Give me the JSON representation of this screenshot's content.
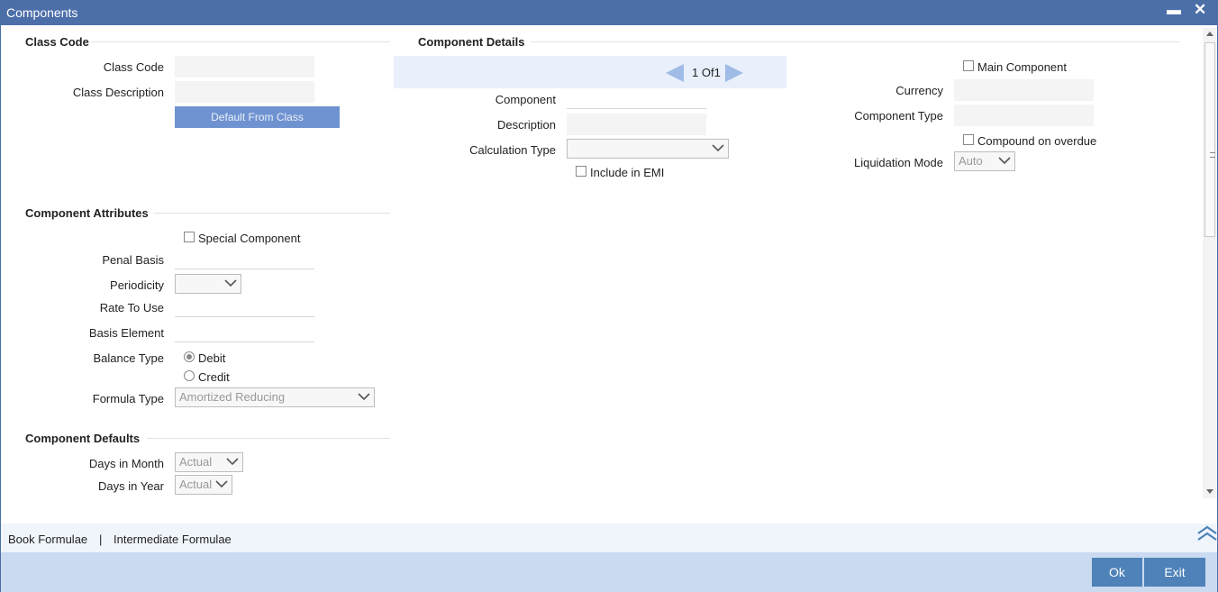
{
  "window": {
    "title": "Components",
    "minimize_glyph": "▬",
    "close_glyph": "✕"
  },
  "class_code": {
    "section_title": "Class Code",
    "class_code_label": "Class Code",
    "class_code_value": "",
    "class_description_label": "Class Description",
    "class_description_value": "",
    "default_button": "Default From Class"
  },
  "component_details": {
    "section_title": "Component Details",
    "nav": {
      "current": "1",
      "of_label": "Of",
      "total": "1"
    },
    "component_label": "Component",
    "component_value": "",
    "description_label": "Description",
    "description_value": "",
    "calculation_type_label": "Calculation Type",
    "calculation_type_value": "",
    "include_in_emi_label": "Include in EMI",
    "include_in_emi_checked": false,
    "main_component_label": "Main Component",
    "main_component_checked": false,
    "currency_label": "Currency",
    "currency_value": "",
    "component_type_label": "Component Type",
    "component_type_value": "",
    "compound_on_overdue_label": "Compound on overdue",
    "compound_on_overdue_checked": false,
    "liquidation_mode_label": "Liquidation Mode",
    "liquidation_mode_value": "Auto"
  },
  "component_attributes": {
    "section_title": "Component Attributes",
    "special_component_label": "Special Component",
    "special_component_checked": false,
    "penal_basis_label": "Penal Basis",
    "penal_basis_value": "",
    "periodicity_label": "Periodicity",
    "periodicity_value": "",
    "rate_to_use_label": "Rate To Use",
    "rate_to_use_value": "",
    "basis_element_label": "Basis Element",
    "basis_element_value": "",
    "balance_type_label": "Balance Type",
    "balance_type_options": [
      "Debit",
      "Credit"
    ],
    "balance_type_selected": "Debit",
    "formula_type_label": "Formula Type",
    "formula_type_value": "Amortized Reducing"
  },
  "component_defaults": {
    "section_title": "Component Defaults",
    "days_in_month_label": "Days in Month",
    "days_in_month_value": "Actual",
    "days_in_year_label": "Days in Year",
    "days_in_year_value": "Actual"
  },
  "footer_links": {
    "book_formulae": "Book Formulae",
    "separator": "|",
    "intermediate_formulae": "Intermediate Formulae"
  },
  "footer_buttons": {
    "ok": "Ok",
    "exit": "Exit"
  },
  "colors": {
    "titlebar": "#4c6ea9",
    "accent_button": "#4f82b8",
    "footer_bar": "#c9daf1",
    "nav_arrow": "#9fbbe6"
  }
}
